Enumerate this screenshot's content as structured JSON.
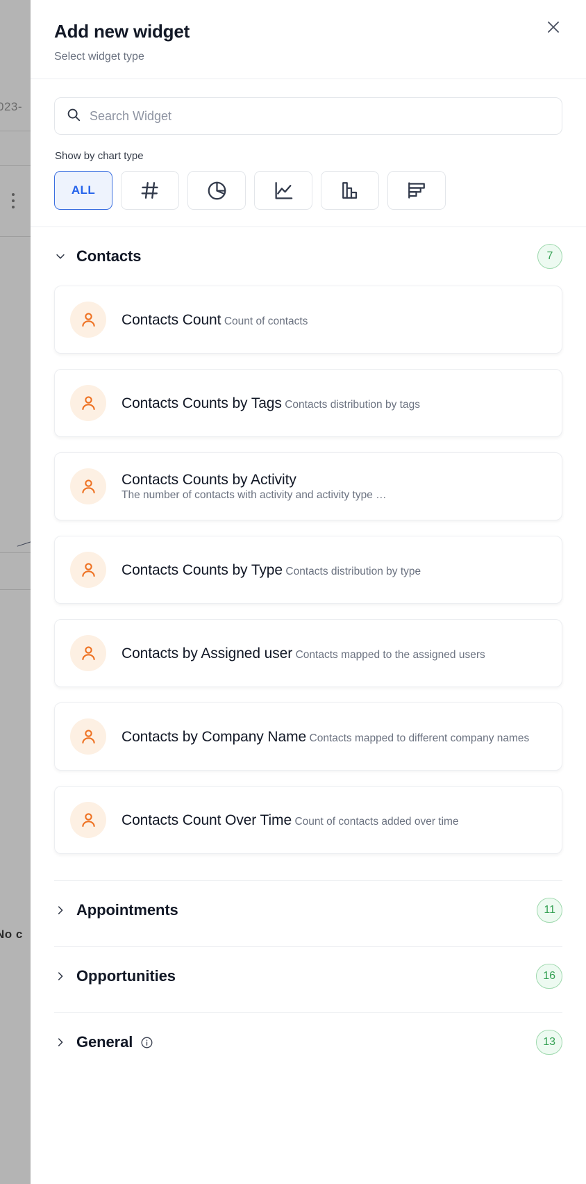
{
  "backdrop": {
    "partial_date_text": "023-",
    "no_data_text": "No c",
    "kebab_icon": "kebab-menu-icon"
  },
  "header": {
    "title": "Add new widget",
    "subtitle": "Select widget type",
    "close_icon": "close-icon"
  },
  "search": {
    "placeholder": "Search Widget",
    "value": "",
    "icon": "search-icon"
  },
  "chart_type_filter": {
    "label": "Show by chart type",
    "options": [
      {
        "id": "all",
        "label": "ALL",
        "icon": "all-text",
        "active": true
      },
      {
        "id": "number",
        "label": "",
        "icon": "hash-number-icon",
        "active": false
      },
      {
        "id": "pie",
        "label": "",
        "icon": "pie-chart-icon",
        "active": false
      },
      {
        "id": "line",
        "label": "",
        "icon": "line-chart-icon",
        "active": false
      },
      {
        "id": "column",
        "label": "",
        "icon": "column-chart-icon",
        "active": false
      },
      {
        "id": "bar",
        "label": "",
        "icon": "bar-chart-icon",
        "active": false
      }
    ],
    "active_color": "#2563eb",
    "active_bg": "#eef3fd"
  },
  "sections": [
    {
      "name": "Contacts",
      "count": "7",
      "expanded": true,
      "chevron": "chevron-down-icon",
      "has_info": false
    },
    {
      "name": "Appointments",
      "count": "11",
      "expanded": false,
      "chevron": "chevron-right-icon",
      "has_info": false
    },
    {
      "name": "Opportunities",
      "count": "16",
      "expanded": false,
      "chevron": "chevron-right-icon",
      "has_info": false
    },
    {
      "name": "General",
      "count": "13",
      "expanded": false,
      "chevron": "chevron-right-icon",
      "has_info": true,
      "info_icon": "info-icon"
    }
  ],
  "contacts_widgets": [
    {
      "title": "Contacts Count",
      "desc": "Count of contacts",
      "icon": "contact-person-icon"
    },
    {
      "title": "Contacts Counts by Tags",
      "desc": "Contacts distribution by tags",
      "icon": "contact-person-icon"
    },
    {
      "title": "Contacts Counts by Activity",
      "desc": "The number of contacts with activity and activity type …",
      "icon": "contact-person-icon"
    },
    {
      "title": "Contacts Counts by Type",
      "desc": "Contacts distribution by type",
      "icon": "contact-person-icon"
    },
    {
      "title": "Contacts by Assigned user",
      "desc": "Contacts mapped to the assigned users",
      "icon": "contact-person-icon"
    },
    {
      "title": "Contacts by Company Name",
      "desc": "Contacts mapped to different company names",
      "icon": "contact-person-icon"
    },
    {
      "title": "Contacts Count Over Time",
      "desc": "Count of contacts added over time",
      "icon": "contact-person-icon"
    }
  ],
  "colors": {
    "accent_blue": "#2563eb",
    "badge_green": "#35a154",
    "icon_orange": "#ee7223",
    "icon_bg": "#fdf0e3",
    "title_dark": "#121826",
    "muted_gray": "#6b7280"
  }
}
